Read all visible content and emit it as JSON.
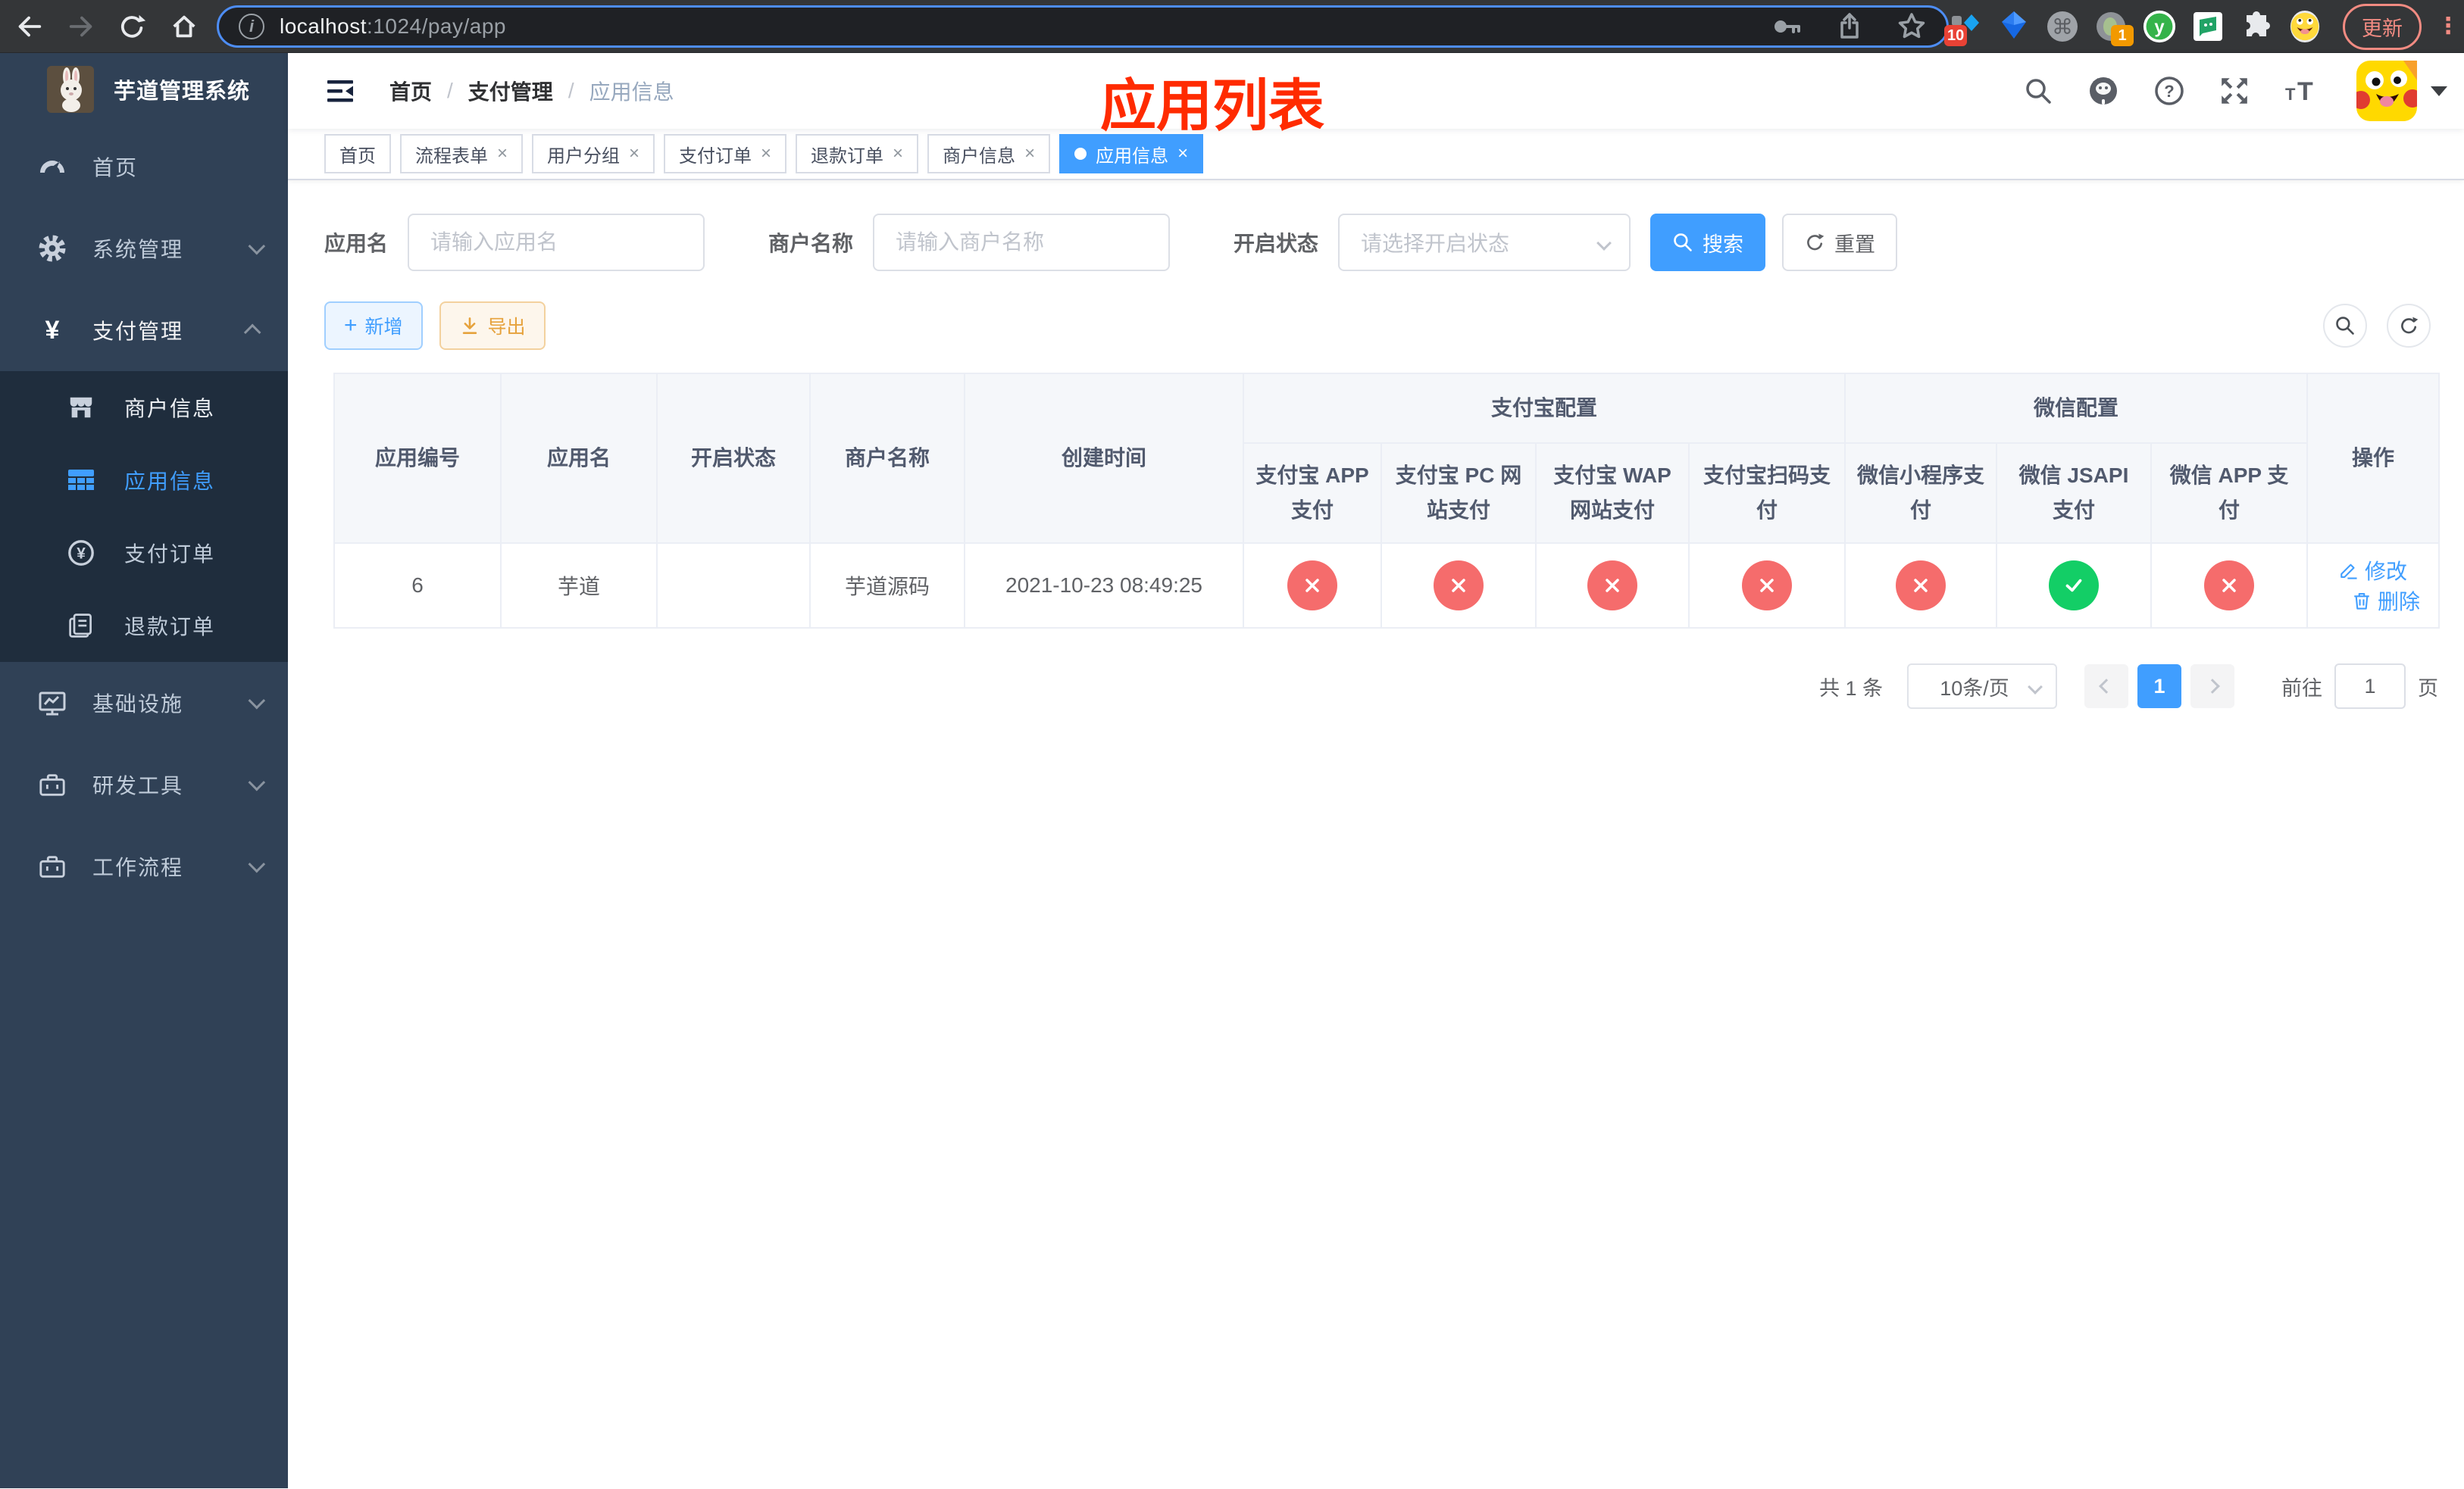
{
  "browser": {
    "url": {
      "host": "localhost",
      "path": ":1024/pay/app"
    },
    "update_button": "更新",
    "extensions": {
      "badge_a": "10",
      "badge_b": "1",
      "y_label": "y"
    }
  },
  "glyphs": {
    "plus": "+",
    "yen": "¥",
    "question": "?",
    "info": "i",
    "command": "⌘",
    "close": "×",
    "t_small": "T",
    "t_large": "T",
    "kebab": "⋮"
  },
  "sidebar": {
    "title": "芋道管理系统",
    "menu": [
      {
        "label": "首页"
      },
      {
        "label": "系统管理"
      },
      {
        "label": "支付管理"
      },
      {
        "label": "基础设施"
      },
      {
        "label": "研发工具"
      },
      {
        "label": "工作流程"
      }
    ],
    "submenu": [
      {
        "label": "商户信息"
      },
      {
        "label": "应用信息"
      },
      {
        "label": "支付订单"
      },
      {
        "label": "退款订单"
      }
    ]
  },
  "navbar": {
    "breadcrumb": [
      "首页",
      "支付管理",
      "应用信息"
    ],
    "separator": "/",
    "annotation": "应用列表"
  },
  "tabs": [
    {
      "label": "首页"
    },
    {
      "label": "流程表单"
    },
    {
      "label": "用户分组"
    },
    {
      "label": "支付订单"
    },
    {
      "label": "退款订单"
    },
    {
      "label": "商户信息"
    },
    {
      "label": "应用信息"
    }
  ],
  "filters": {
    "app_name": {
      "label": "应用名",
      "placeholder": "请输入应用名"
    },
    "merchant": {
      "label": "商户名称",
      "placeholder": "请输入商户名称"
    },
    "status": {
      "label": "开启状态",
      "placeholder": "请选择开启状态"
    },
    "search_button": "搜索",
    "reset_button": "重置"
  },
  "toolbar": {
    "add_button": "新增",
    "export_button": "导出"
  },
  "table": {
    "headers": {
      "app_id": "应用编号",
      "app_name": "应用名",
      "status": "开启状态",
      "merchant": "商户名称",
      "created": "创建时间",
      "alipay_group": "支付宝配置",
      "wechat_group": "微信配置",
      "alipay_app": "支付宝 APP 支付",
      "alipay_pc": "支付宝 PC 网站支付",
      "alipay_wap": "支付宝 WAP 网站支付",
      "alipay_scan": "支付宝扫码支付",
      "wechat_lite": "微信小程序支付",
      "wechat_jsapi": "微信 JSAPI 支付",
      "wechat_app": "微信 APP 支付",
      "ops": "操作"
    },
    "rows": [
      {
        "app_id": "6",
        "app_name": "芋道",
        "enabled": true,
        "merchant": "芋道源码",
        "created": "2021-10-23 08:49:25",
        "statuses": [
          "fail",
          "fail",
          "fail",
          "fail",
          "fail",
          "pass",
          "fail"
        ],
        "edit_label": "修改",
        "delete_label": "删除"
      }
    ]
  },
  "pagination": {
    "total": "共 1 条",
    "page_size": "10条/页",
    "current_page": "1",
    "goto_prefix": "前往",
    "goto_value": "1",
    "goto_suffix": "页"
  },
  "colors": {
    "primary": "#409eff",
    "success": "#13ce66",
    "danger": "#f56c6c",
    "warning": "#e6a23c",
    "sidebar_bg": "#304156",
    "submenu_bg": "#1f2d3d",
    "annotation_red": "#ff2b00",
    "table_header_bg": "#f5f7fa",
    "url_focus_ring": "#4d8df6"
  }
}
